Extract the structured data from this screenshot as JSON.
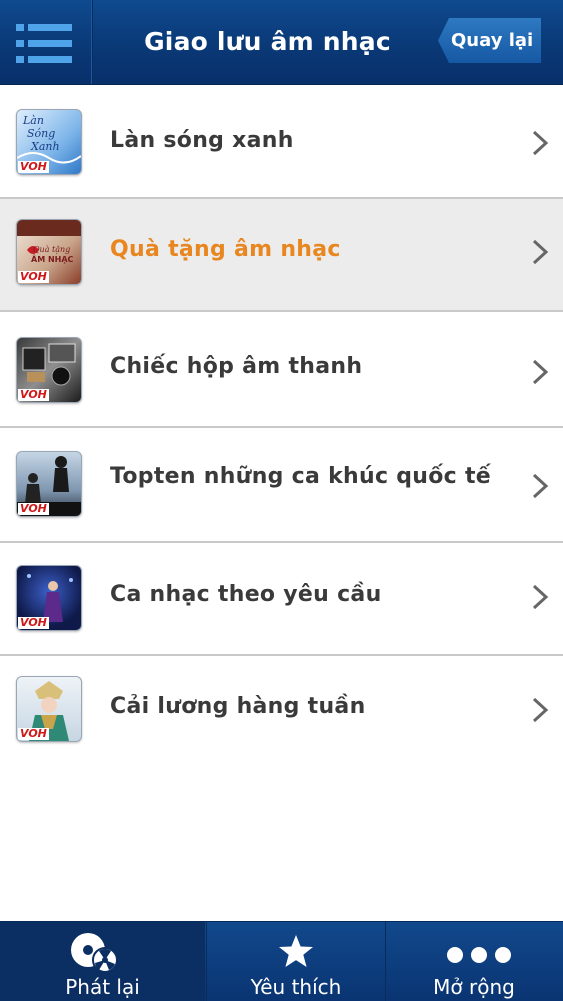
{
  "header": {
    "title": "Giao lưu âm nhạc",
    "back_label": "Quay lại"
  },
  "list": {
    "items": [
      {
        "label": "Làn sóng xanh",
        "thumb_text": "Làn Sóng Xanh",
        "thumb_tag": "VOH",
        "selected": false
      },
      {
        "label": "Quà tặng âm nhạc",
        "thumb_text": "Quà tặng ÂM NHẠC",
        "thumb_tag": "VOH",
        "selected": true
      },
      {
        "label": "Chiếc hộp âm thanh",
        "thumb_tag": "VOH",
        "selected": false
      },
      {
        "label": "Topten những ca khúc quốc tế",
        "thumb_tag": "VOH",
        "selected": false
      },
      {
        "label": "Ca nhạc theo yêu cầu",
        "thumb_tag": "VOH",
        "selected": false
      },
      {
        "label": "Cải lương hàng tuần",
        "thumb_tag": "VOH",
        "selected": false
      }
    ]
  },
  "tabbar": {
    "tabs": [
      {
        "label": "Phát lại",
        "icon": "disc-icon",
        "active": true
      },
      {
        "label": "Yêu thích",
        "icon": "star-icon",
        "active": false
      },
      {
        "label": "Mở rộng",
        "icon": "more-dots-icon",
        "active": false
      }
    ]
  },
  "colors": {
    "header_bg": "#0a3977",
    "selected_text": "#e8861f",
    "text": "#3a3a3a",
    "selected_row_bg": "#ececec"
  }
}
